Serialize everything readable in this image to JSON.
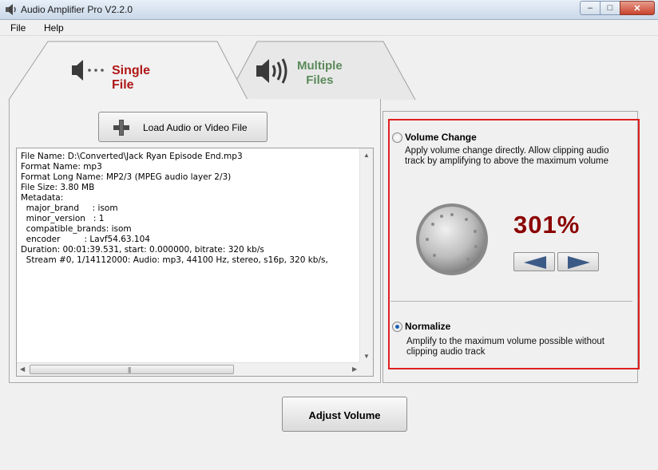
{
  "window": {
    "title": "Audio Amplifier Pro V2.2.0",
    "minimize": "–",
    "maximize": "□",
    "close": "✕"
  },
  "menu": {
    "file": "File",
    "help": "Help"
  },
  "tabs": {
    "single": "Single File",
    "multiple_line1": "Multiple",
    "multiple_line2": "Files",
    "active": "single"
  },
  "load_button": {
    "label": "Load Audio or Video File",
    "icon": "plus-icon"
  },
  "file_info": {
    "lines": [
      "File Name: D:\\Converted\\Jack Ryan Episode End.mp3",
      "Format Name: mp3",
      "Format Long Name: MP2/3 (MPEG audio layer 2/3)",
      "File Size: 3.80 MB",
      "Metadata:",
      "  major_brand     : isom",
      "  minor_version   : 1",
      "  compatible_brands: isom",
      "  encoder         : Lavf54.63.104",
      "Duration: 00:01:39.531, start: 0.000000, bitrate: 320 kb/s",
      "  Stream #0, 1/14112000: Audio: mp3, 44100 Hz, stereo, s16p, 320 kb/s,"
    ]
  },
  "volume_change": {
    "title": "Volume Change",
    "description": "Apply volume change directly. Allow clipping audio track by amplifying to above the maximum volume",
    "selected": false,
    "percent": "301%",
    "decrease_icon": "left-arrow-icon",
    "increase_icon": "right-arrow-icon"
  },
  "normalize": {
    "title": "Normalize",
    "description": "Amplify to the maximum volume possible without clipping audio track",
    "selected": true
  },
  "adjust_button": {
    "label": "Adjust Volume"
  },
  "colors": {
    "highlight_border": "#e02020",
    "percent_text": "#8b0000",
    "single_tab_text": "#b01818",
    "multi_tab_text": "#5a8a5a"
  }
}
